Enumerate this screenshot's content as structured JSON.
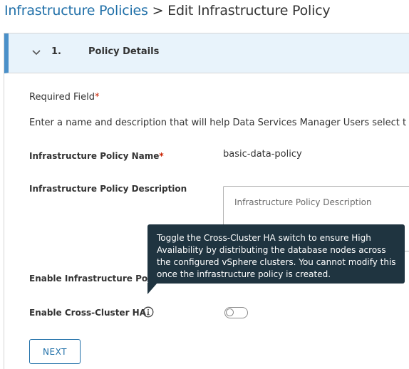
{
  "breadcrumb": {
    "parent": "Infrastructure Policies",
    "separator": " > ",
    "current": "Edit Infrastructure Policy"
  },
  "step": {
    "number": "1.",
    "title": "Policy Details"
  },
  "form": {
    "required_label": "Required Field",
    "required_marker": "*",
    "intro": "Enter a name and description that will help Data Services Manager Users select t",
    "name_label": "Infrastructure Policy Name",
    "name_value": "basic-data-policy",
    "description_label": "Infrastructure Policy Description",
    "description_placeholder": "Infrastructure Policy Description",
    "enable_policy_label": "Enable Infrastructure Policy",
    "enable_cross_cluster_label": "Enable Cross-Cluster HA",
    "next_label": "NEXT"
  },
  "tooltip": {
    "text": "Toggle the Cross-Cluster HA switch to ensure High Availability by distributing the database nodes across the configured vSphere clusters. You cannot modify this once the infrastructure policy is created."
  },
  "colors": {
    "link": "#1f6fa8",
    "header_bg": "#e8f3fb",
    "accent_bar": "#4a90c9",
    "tooltip_bg": "#1f3440",
    "required": "#c92100"
  }
}
